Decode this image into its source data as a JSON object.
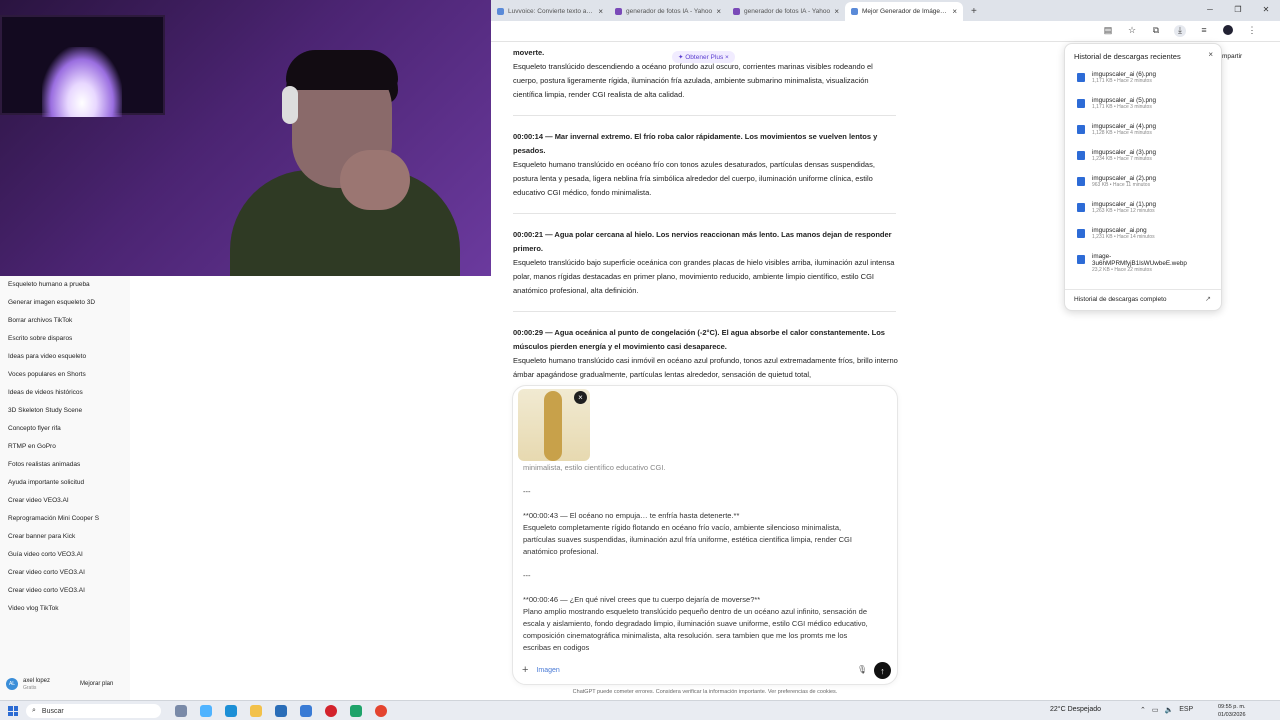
{
  "browser": {
    "tabs": [
      {
        "label": "Luvvoice: Convierte texto a voz",
        "close": "×"
      },
      {
        "label": "generador de fotos IA - Yahoo",
        "close": "×"
      },
      {
        "label": "generador de fotos IA - Yahoo",
        "close": "×"
      },
      {
        "label": "Mejor Generador de Imágenes",
        "close": "×"
      }
    ],
    "new_tab": "+",
    "window_controls": [
      "─",
      "❐",
      "✕"
    ]
  },
  "chat": {
    "upgrade_pill": "✦ Obtener Plus ×",
    "messages": [
      {
        "title": "moverte.",
        "body": "Esqueleto translúcido descendiendo a océano profundo azul oscuro, corrientes marinas visibles rodeando el cuerpo, postura ligeramente rígida, iluminación fría azulada, ambiente submarino minimalista, visualización científica limpia, render CGI realista de alta calidad."
      },
      {
        "title": "00:00:14 — Mar invernal extremo. El frío roba calor rápidamente. Los movimientos se vuelven lentos y pesados.",
        "body": "Esqueleto humano translúcido en océano frío con tonos azules desaturados, partículas densas suspendidas, postura lenta y pesada, ligera neblina fría simbólica alrededor del cuerpo, iluminación uniforme clínica, estilo educativo CGI médico, fondo minimalista."
      },
      {
        "title": "00:00:21 — Agua polar cercana al hielo. Los nervios reaccionan más lento. Las manos dejan de responder primero.",
        "body": "Esqueleto translúcido bajo superficie oceánica con grandes placas de hielo visibles arriba, iluminación azul intensa polar, manos rígidas destacadas en primer plano, movimiento reducido, ambiente limpio científico, estilo CGI anatómico profesional, alta definición."
      },
      {
        "title": "00:00:29 — Agua oceánica al punto de congelación (-2°C). El agua absorbe el calor constantemente. Los músculos pierden energía y el movimiento casi desaparece.",
        "body": "Esqueleto humano translúcido casi inmóvil en océano azul profundo, tonos azul extremadamente fríos, brillo interno ámbar apagándose gradualmente, partículas lentas alrededor, sensación de quietud total,"
      }
    ]
  },
  "composer": {
    "lines": [
      "minimalista, estilo científico educativo CGI.",
      "---",
      "**00:00:43 — El océano no empuja… te enfría hasta detenerte.**",
      "Esqueleto completamente rígido flotando en océano frío vacío, ambiente silencioso minimalista, partículas suaves suspendidas, iluminación azul fría uniforme, estética científica limpia, render CGI anatómico profesional.",
      "---",
      "**00:00:46 — ¿En qué nivel crees que tu cuerpo dejaría de moverse?**",
      "Plano amplio mostrando esqueleto translúcido pequeño dentro de un océano azul infinito, sensación de escala y aislamiento, fondo degradado limpio, iluminación suave uniforme, estilo CGI médico educativo, composición cinematográfica minimalista, alta resolución. sera tambien que me los promts me los escribas en codigos"
    ],
    "plus": "+",
    "image_button": "Imagen",
    "remove_image": "×",
    "send": "↑",
    "mic": "🎙",
    "footnote": "ChatGPT puede cometer errores. Considera verificar la información importante. Ver preferencias de cookies."
  },
  "sidebar": {
    "items": [
      "Esqueleto humano a prueba",
      "Generar imagen esqueleto 3D",
      "Borrar archivos TikTok",
      "Escrito sobre disparos",
      "Ideas para video esqueleto",
      "Voces populares en Shorts",
      "Ideas de videos históricos",
      "3D Skeleton Study Scene",
      "Concepto flyer rifa",
      "RTMP en GoPro",
      "Fotos realistas animadas",
      "Ayuda importante solicitud",
      "Crear video VEO3.AI",
      "Reprogramación Mini Cooper S",
      "Crear banner para Kick",
      "Guía video corto VEO3.AI",
      "Crear video corto VEO3.AI",
      "Crear video corto VEO3.AI",
      "Video vlog TikTok"
    ],
    "user_initials": "AL",
    "user_name": "axel lopez",
    "user_plan": "Gratis",
    "upgrade": "Mejorar plan"
  },
  "downloads": {
    "title": "Historial de descargas recientes",
    "close": "×",
    "items": [
      {
        "name": "imgupscaler_ai (6).png",
        "meta": "1,171 KB • Hace 2 minutos"
      },
      {
        "name": "imgupscaler_ai (5).png",
        "meta": "1,171 KB • Hace 3 minutos"
      },
      {
        "name": "imgupscaler_ai (4).png",
        "meta": "1,128 KB • Hace 4 minutos"
      },
      {
        "name": "imgupscaler_ai (3).png",
        "meta": "1,234 KB • Hace 7 minutos"
      },
      {
        "name": "imgupscaler_ai (2).png",
        "meta": "963 KB • Hace 11 minutos"
      },
      {
        "name": "imgupscaler_ai (1).png",
        "meta": "1,263 KB • Hace 12 minutos"
      },
      {
        "name": "imgupscaler_ai.png",
        "meta": "1,231 KB • Hace 14 minutos"
      },
      {
        "name": "image-",
        "name2": "3u6hMPRMfyjB1lsWUwbeE.webp",
        "meta": "23,2 KB • Hace 22 minutos"
      }
    ],
    "full_history": "Historial de descargas completo",
    "share": "mpartir"
  },
  "taskbar": {
    "search": "Buscar",
    "weather": "22°C  Despejado",
    "lang": "ESP",
    "time": "09:55 p. m.",
    "date": "01/03/2026"
  }
}
